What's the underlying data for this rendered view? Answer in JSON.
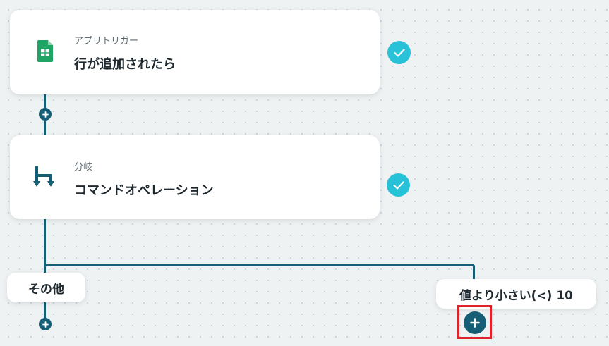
{
  "trigger_card": {
    "label": "アプリトリガー",
    "title": "行が追加されたら",
    "icon": "google-sheets-icon"
  },
  "branch_card": {
    "label": "分岐",
    "title": "コマンドオペレーション",
    "icon": "branch-icon"
  },
  "branches": {
    "other_label": "その他",
    "condition_label": "値より小さい(<) 10"
  },
  "colors": {
    "connector": "#155e75",
    "check": "#27c1d8",
    "sheets_green": "#1fa463",
    "highlight": "#e0232a"
  }
}
